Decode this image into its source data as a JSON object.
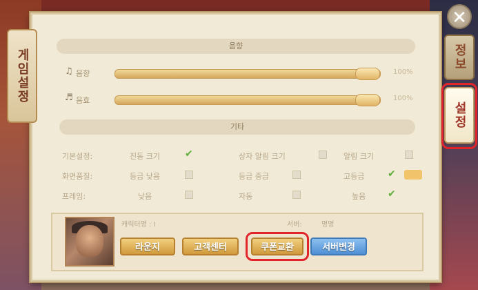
{
  "left_tab": {
    "label": "게임설정"
  },
  "right_tabs": {
    "info": "정보",
    "settings": "설정"
  },
  "sound_section": {
    "title": "음향"
  },
  "volume_rows": [
    {
      "icon": "headphones-icon",
      "glyph": "♫",
      "label": "음향",
      "value_text": "100%",
      "level": 1.0
    },
    {
      "icon": "music-note-icon",
      "glyph": "♬",
      "label": "음효",
      "value_text": "100%",
      "level": 1.0
    }
  ],
  "etc_section": {
    "title": "기타"
  },
  "options": {
    "row1": {
      "label": "기본설정:",
      "a": "진동 크기",
      "b": "상자 알림 크기",
      "c": "알림 크기"
    },
    "row2": {
      "label": "화면품질:",
      "a": "등급 낮음",
      "b": "등급 중급",
      "c": "고등급"
    },
    "row3": {
      "label": "프레임:",
      "a": "낮음",
      "b": "자동",
      "c": "높음"
    }
  },
  "profile": {
    "nickname_label": "캐릭터명 : I",
    "server_label": "서버:",
    "server_value": "명명"
  },
  "buttons": {
    "lounge": "라운지",
    "customer_center": "고객센터",
    "coupon_exchange": "쿠폰교환",
    "server_change": "서버변경"
  },
  "colors": {
    "highlight": "#e1252b",
    "gold_button": "#d09a3c",
    "blue_button": "#4f8fd4",
    "check": "#5fae3b"
  }
}
